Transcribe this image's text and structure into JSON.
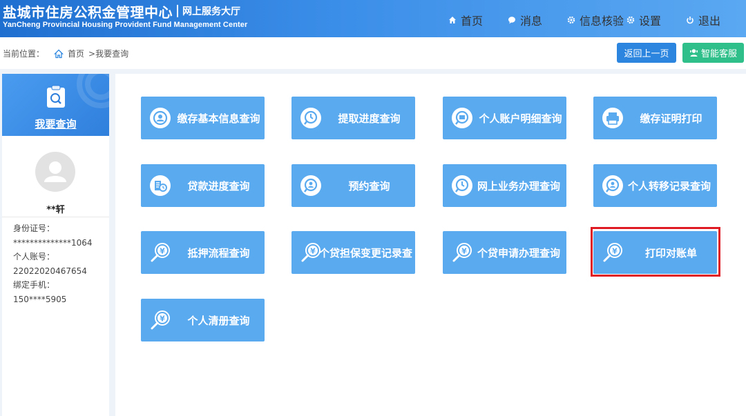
{
  "header": {
    "title": "盐城市住房公积金管理中心",
    "subtitle": "网上服务大厅",
    "title_en": "YanCheng Provincial Housing Provident Fund Management Center",
    "nav": [
      {
        "label": "首页",
        "icon": "home-icon"
      },
      {
        "label": "消息",
        "icon": "message-icon"
      },
      {
        "label": "信息核验",
        "icon": "gear-icon"
      },
      {
        "label": "设置",
        "icon": "gear-icon"
      },
      {
        "label": "退出",
        "icon": "power-icon"
      }
    ]
  },
  "breadcrumb": {
    "prefix": "当前位置：",
    "home": "首页",
    "current": ">我要查询"
  },
  "actions": {
    "back_label": "返回上一页",
    "service_label": "智能客服"
  },
  "sidebar": {
    "title": "我要查询",
    "user_name": "**轩",
    "fields": [
      {
        "label": "身份证号：",
        "value": "**************1064"
      },
      {
        "label": "个人账号：",
        "value": "22022020467654"
      },
      {
        "label": "绑定手机：",
        "value": "150****5905"
      }
    ]
  },
  "tiles": [
    {
      "label": "缴存基本信息查询",
      "icon": "user-search-icon"
    },
    {
      "label": "提取进度查询",
      "icon": "clock-search-icon"
    },
    {
      "label": "个人账户明细查询",
      "icon": "account-search-icon"
    },
    {
      "label": "缴存证明打印",
      "icon": "printer-icon"
    },
    {
      "label": "贷款进度查询",
      "icon": "loan-progress-icon"
    },
    {
      "label": "预约查询",
      "icon": "appointment-icon"
    },
    {
      "label": "网上业务办理查询",
      "icon": "clock-search-icon"
    },
    {
      "label": "个人转移记录查询",
      "icon": "transfer-icon"
    },
    {
      "label": "抵押流程查询",
      "icon": "yuan-magnifier-icon"
    },
    {
      "label": "个贷担保变更记录查",
      "icon": "yuan-magnifier-icon"
    },
    {
      "label": "个贷申请办理查询",
      "icon": "yuan-magnifier-icon"
    },
    {
      "label": "打印对账单",
      "icon": "yuan-magnifier-icon"
    },
    {
      "label": "个人清册查询",
      "icon": "yuan-magnifier-icon"
    }
  ],
  "colors": {
    "header_start": "#1f6fd0",
    "header_end": "#5aa8f2",
    "tile": "#5aaaf0",
    "back_button": "#2c86e0",
    "service_button": "#2fbf8a",
    "highlight": "#e01a22"
  }
}
